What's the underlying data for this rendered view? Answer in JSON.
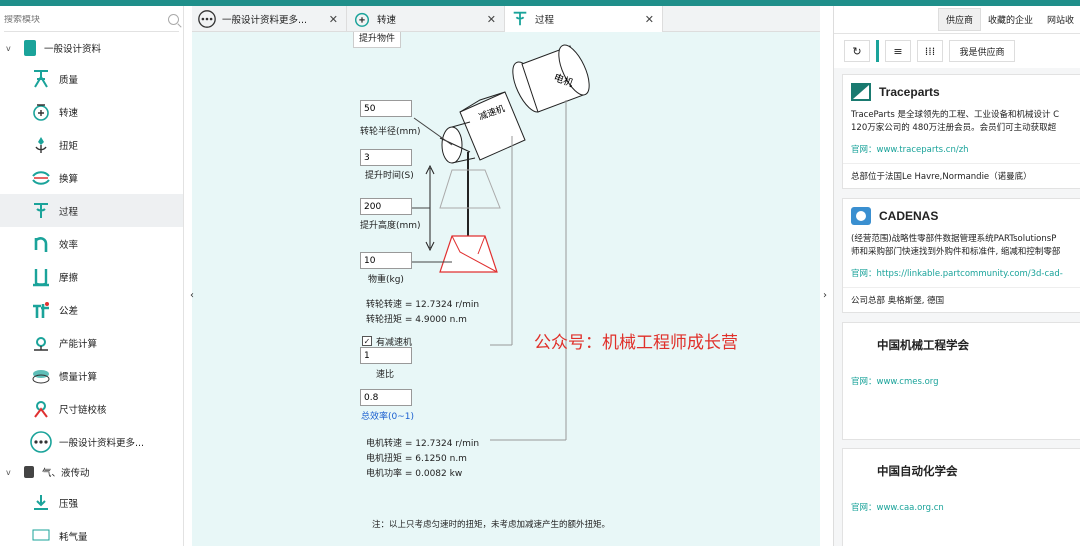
{
  "sidebar": {
    "search_placeholder": "搜索模块",
    "group1": "一般设计资料",
    "items": [
      {
        "label": "质量",
        "icon": "mass-icon"
      },
      {
        "label": "转速",
        "icon": "speed-icon"
      },
      {
        "label": "扭矩",
        "icon": "torque-icon"
      },
      {
        "label": "换算",
        "icon": "convert-icon"
      },
      {
        "label": "过程",
        "icon": "process-icon"
      },
      {
        "label": "效率",
        "icon": "efficiency-icon"
      },
      {
        "label": "摩擦",
        "icon": "friction-icon"
      },
      {
        "label": "公差",
        "icon": "tolerance-icon"
      },
      {
        "label": "产能计算",
        "icon": "capacity-icon"
      },
      {
        "label": "惯量计算",
        "icon": "inertia-icon"
      },
      {
        "label": "尺寸链校核",
        "icon": "dimension-chain-icon"
      },
      {
        "label": "一般设计资料更多...",
        "icon": "more-icon"
      }
    ],
    "group2": "气、液传动",
    "items2": [
      {
        "label": "压强",
        "icon": "pressure-icon"
      },
      {
        "label": "耗气量",
        "icon": "air-icon"
      }
    ]
  },
  "tabs": [
    {
      "label": "一般设计资料更多..."
    },
    {
      "label": "转速"
    },
    {
      "label": "过程"
    }
  ],
  "subtab": "提升物件",
  "form": {
    "radius_value": "50",
    "radius_label": "转轮半径(mm)",
    "time_value": "3",
    "time_label": "提升时间(S)",
    "height_value": "200",
    "height_label": "提升高度(mm)",
    "weight_value": "10",
    "weight_label": "物重(kg)",
    "wheel_speed": "转轮转速 = 12.7324 r/min",
    "wheel_torque": "转轮扭矩 = 4.9000 n.m",
    "reducer_checkbox": "有减速机",
    "ratio_value": "1",
    "ratio_label": "速比",
    "eff_value": "0.8",
    "eff_label": "总效率(0~1)",
    "motor_speed": "电机转速 = 12.7324 r/min",
    "motor_torque": "电机扭矩 = 6.1250 n.m",
    "motor_power": "电机功率 = 0.0082 kw",
    "note": "注：以上只考虑匀速时的扭矩，未考虑加减速产生的额外扭矩。"
  },
  "diagram": {
    "reducer_text": "减速机",
    "motor_text": "电机"
  },
  "watermark": "公众号：机械工程师成长营",
  "right": {
    "tabs": [
      "供应商",
      "收藏的企业",
      "网站收"
    ],
    "supplier_button": "我是供应商",
    "cards": [
      {
        "name": "Traceparts",
        "desc1": "TraceParts 是全球领先的工程、工业设备和机械设计 C",
        "desc2": "120万家公司的 480万注册会员。会员们可主动获取超",
        "site": "官网：www.traceparts.cn/zh",
        "foot": "总部位于法国Le Havre,Normandie（诺曼底）"
      },
      {
        "name": "CADENAS",
        "desc1": "(经营范围)战略性零部件数据管理系统PARTsolutionsP",
        "desc2": "师和采购部门快速找到外购件和标准件, 缩减和控制零部",
        "site": "官网：https://linkable.partcommunity.com/3d-cad-",
        "foot": "公司总部  奥格斯堡, 德国"
      },
      {
        "name": "中国机械工程学会",
        "site": "官网：www.cmes.org"
      },
      {
        "name": "中国自动化学会",
        "site": "官网：www.caa.org.cn"
      }
    ]
  },
  "colors": {
    "accent": "#1aa39a",
    "topbar": "#1f8f8a",
    "canvas": "#e8f7f7",
    "red": "#e0302a"
  }
}
